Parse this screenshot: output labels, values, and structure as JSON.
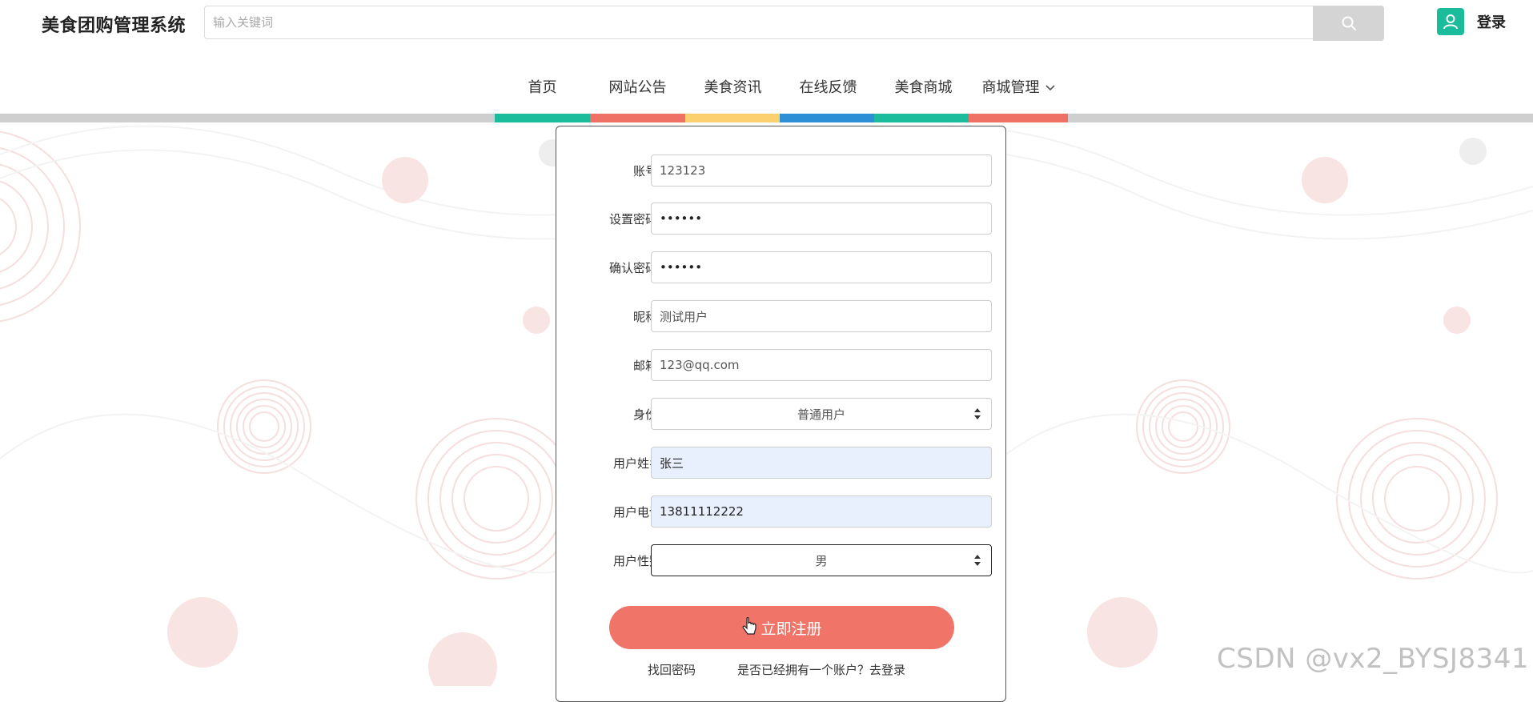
{
  "header": {
    "brand": "美食团购管理系统",
    "search_placeholder": "输入关键词",
    "login_label": "登录"
  },
  "nav": {
    "items": [
      {
        "label": "首页"
      },
      {
        "label": "网站公告"
      },
      {
        "label": "美食资讯"
      },
      {
        "label": "在线反馈"
      },
      {
        "label": "美食商城"
      },
      {
        "label": "商城管理"
      }
    ],
    "colors": [
      "#1abc9c",
      "#ef7065",
      "#fcd06e",
      "#2d8fd6",
      "#1abc9c",
      "#ef7065"
    ]
  },
  "form": {
    "account": {
      "label": "账号:",
      "value": "123123"
    },
    "password": {
      "label": "设置密码:",
      "value": "••••••"
    },
    "confirm": {
      "label": "确认密码:",
      "value": "••••••"
    },
    "nickname": {
      "label": "昵称:",
      "value": "测试用户"
    },
    "email": {
      "label": "邮箱:",
      "value": "123@qq.com"
    },
    "role": {
      "label": "身份:",
      "value": "普通用户"
    },
    "name": {
      "label": "用户姓名",
      "value": "张三"
    },
    "phone": {
      "label": "用户电话",
      "value": "13811112222"
    },
    "gender": {
      "label": "用户性别",
      "value": "男"
    },
    "submit_label": "立即注册",
    "forgot_label": "找回密码",
    "have_account_label": "是否已经拥有一个账户？去登录"
  },
  "watermark": "CSDN @vx2_BYSJ8341",
  "colors": {
    "accent": "#f07468",
    "brand_green": "#1abc9c"
  },
  "icons": {
    "search": "search-icon",
    "user": "user-icon",
    "chevron": "chevron-down-icon",
    "select": "select-arrows-icon"
  }
}
